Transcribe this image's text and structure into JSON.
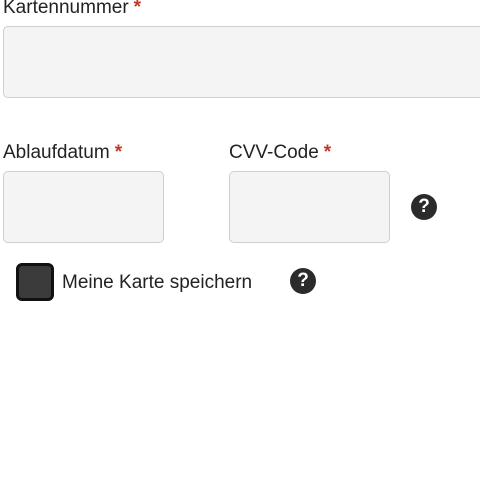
{
  "card_number": {
    "label": "Kartennummer",
    "required_mark": "*",
    "value": ""
  },
  "expiry_date": {
    "label": "Ablaufdatum",
    "required_mark": "*",
    "value": ""
  },
  "cvv": {
    "label": "CVV-Code",
    "required_mark": "*",
    "value": "",
    "help_icon": "question-circle",
    "help_glyph": "?"
  },
  "save_card": {
    "label": "Meine Karte speichern",
    "checked": false,
    "help_icon": "question-circle",
    "help_glyph": "?"
  },
  "colors": {
    "required": "#c0392b",
    "field_background": "#f4f4f4",
    "icon": "#2b2b2b"
  }
}
